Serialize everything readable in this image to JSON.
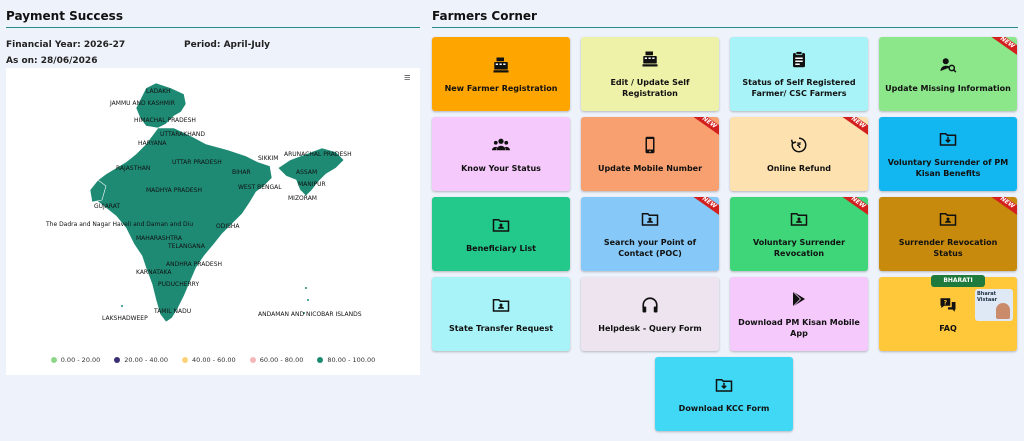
{
  "payment": {
    "title": "Payment Success",
    "financial_year": "Financial Year: 2026-27",
    "period": "Period: April-July",
    "as_on": "As on: 28/06/2026",
    "legend": [
      {
        "label": "0.00 - 20.00",
        "color": "#8fd68a"
      },
      {
        "label": "20.00 - 40.00",
        "color": "#3b2f73"
      },
      {
        "label": "40.00 - 60.00",
        "color": "#ffd27a"
      },
      {
        "label": "60.00 - 80.00",
        "color": "#f5b8b8"
      },
      {
        "label": "80.00 - 100.00",
        "color": "#1e8a74"
      }
    ],
    "map_labels": {
      "ladakh": "LADAKH",
      "jk": "JAMMU AND KASHMIR",
      "hp": "HIMACHAL PRADESH",
      "uk": "UTTARAKHAND",
      "haryana": "HARYANA",
      "up": "UTTAR PRADESH",
      "rajasthan": "RAJASTHAN",
      "mp": "MADHYA PRADESH",
      "bihar": "BIHAR",
      "sikkim": "SIKKIM",
      "arunachal": "ARUNACHAL PRADESH",
      "assam": "ASSAM",
      "wb": "WEST BENGAL",
      "manipur": "MANIPUR",
      "mizoram": "MIZORAM",
      "gujarat": "GUJARAT",
      "dnh": "The Dadra and Nagar Haveli and Daman and Diu",
      "odisha": "ODISHA",
      "maharashtra": "MAHARASHTRA",
      "telangana": "TELANGANA",
      "ap": "ANDHRA PRADESH",
      "karnataka": "KARNATAKA",
      "puducherry": "PUDUCHERRY",
      "tn": "TAMIL NADU",
      "lakshadweep": "LAKSHADWEEP",
      "andaman": "ANDAMAN AND NICOBAR ISLANDS"
    }
  },
  "farmers": {
    "title": "Farmers Corner",
    "new_badge": "NEW",
    "bharati_label": "BHARATI",
    "vistaar_text": "Bharat Vistaar",
    "tiles": [
      {
        "label": "New Farmer Registration",
        "color": "#ffa500",
        "icon": "register-icon"
      },
      {
        "label": "Edit / Update Self Registration",
        "color": "#eef1a8",
        "icon": "register-icon"
      },
      {
        "label": "Status of Self Registered Farmer/ CSC Farmers",
        "color": "#a8f3f7",
        "icon": "clipboard-icon"
      },
      {
        "label": "Update Missing Information",
        "color": "#8ce68a",
        "icon": "user-search-icon"
      },
      {
        "label": "Know Your Status",
        "color": "#f5c9fb",
        "icon": "users-icon"
      },
      {
        "label": "Update Mobile Number",
        "color": "#f9a070",
        "icon": "mobile-icon"
      },
      {
        "label": "Online Refund",
        "color": "#fde2b0",
        "icon": "rupee-refund-icon"
      },
      {
        "label": "Voluntary Surrender of PM Kisan Benefits",
        "color": "#12b6f0",
        "icon": "folder-download-icon"
      },
      {
        "label": "Beneficiary List",
        "color": "#22c98a",
        "icon": "folder-user-icon"
      },
      {
        "label": "Search your Point of Contact (POC)",
        "color": "#86c8f7",
        "icon": "folder-user-icon"
      },
      {
        "label": "Voluntary Surrender Revocation",
        "color": "#3fd67a",
        "icon": "folder-user-icon"
      },
      {
        "label": "Surrender Revocation Status",
        "color": "#c78a0d",
        "icon": "folder-user-icon"
      },
      {
        "label": "State Transfer Request",
        "color": "#a8f3f7",
        "icon": "folder-user-icon"
      },
      {
        "label": "Helpdesk - Query Form",
        "color": "#ede4ef",
        "icon": "headphones-icon"
      },
      {
        "label": "Download PM Kisan Mobile App",
        "color": "#f5c9fb",
        "icon": "play-store-icon"
      },
      {
        "label": "FAQ",
        "color": "#ffc83a",
        "icon": "faq-icon"
      },
      {
        "label": "Download KCC Form",
        "color": "#40d8f5",
        "icon": "folder-download-icon"
      }
    ]
  }
}
